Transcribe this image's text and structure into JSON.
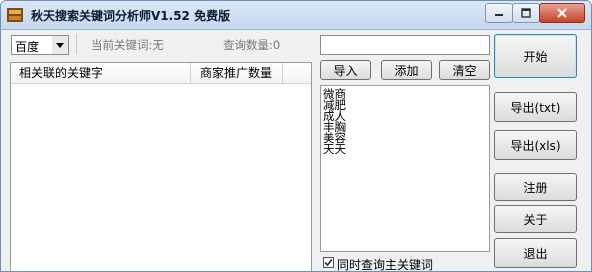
{
  "window": {
    "title": "秋天搜索关键词分析师V1.52 免费版"
  },
  "toolbar": {
    "engine_selected": "百度",
    "current_keyword": "当前关键词:无",
    "query_count": "查询数量:0"
  },
  "results_table": {
    "columns": [
      "相关联的关键字",
      "商家推广数量"
    ],
    "rows": []
  },
  "keyword_panel": {
    "search_value": "",
    "import_label": "导入",
    "add_label": "添加",
    "clear_label": "清空",
    "keywords": [
      "微商",
      "减肥",
      "成人",
      "丰胸",
      "美容",
      "天天"
    ],
    "also_query_main_label": "同时查询主关键词",
    "also_query_main_checked": true
  },
  "actions": {
    "start_label": "开始",
    "export_txt_label": "导出(txt)",
    "export_xls_label": "导出(xls)",
    "register_label": "注册",
    "about_label": "关于",
    "exit_label": "退出"
  }
}
